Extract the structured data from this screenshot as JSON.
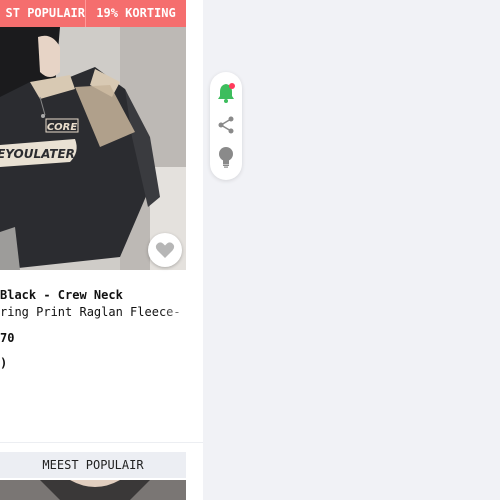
{
  "product_card": {
    "badge_popular": "ST POPULAIR",
    "badge_discount": "19% KORTING",
    "title_line1": "Black - Crew Neck",
    "title_line2": "ring Print Raglan Fleece-",
    "price": "70",
    "price_secondary": ")",
    "photo_text_core": "CORE",
    "photo_text_slogan": "EYOULATER",
    "wishlist_icon": "heart-icon"
  },
  "next_card": {
    "badge_popular": "MEEST POPULAIR"
  },
  "floating_actions": [
    {
      "name": "notification-bell-icon",
      "color": "#3dbd5d"
    },
    {
      "name": "share-icon",
      "color": "#8a8a8a"
    },
    {
      "name": "lightbulb-icon",
      "color": "#8a8a8a"
    }
  ],
  "colors": {
    "badge": "#f56e6e",
    "notification_dot": "#ff3b5c"
  }
}
